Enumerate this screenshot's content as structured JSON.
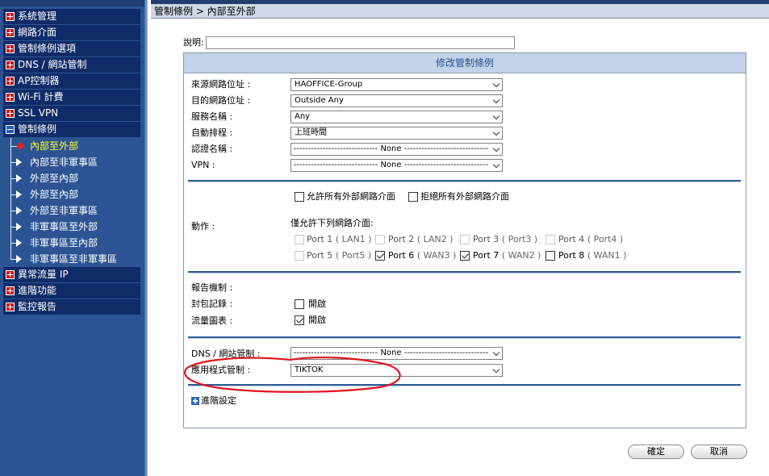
{
  "sidebar": {
    "items": [
      {
        "label": "系統管理",
        "type": "plus"
      },
      {
        "label": "網路介面",
        "type": "plus"
      },
      {
        "label": "管制條例選項",
        "type": "plus"
      },
      {
        "label": "DNS / 網站管制",
        "type": "plus"
      },
      {
        "label": "AP控制器",
        "type": "plus"
      },
      {
        "label": "Wi-Fi 計費",
        "type": "plus"
      },
      {
        "label": "SSL VPN",
        "type": "plus"
      },
      {
        "label": "管制條例",
        "type": "minus"
      }
    ],
    "subitems": [
      {
        "label": "內部至外部",
        "active": true
      },
      {
        "label": "內部至非軍事區"
      },
      {
        "label": "外部至內部"
      },
      {
        "label": "外部至內部"
      },
      {
        "label": "外部至非軍事區"
      },
      {
        "label": "非軍事區至外部"
      },
      {
        "label": "非軍事區至內部"
      },
      {
        "label": "非軍事區至非軍事區"
      }
    ],
    "items_after": [
      {
        "label": "異常流量 IP"
      },
      {
        "label": "進階功能"
      },
      {
        "label": "監控報告"
      }
    ]
  },
  "header": {
    "breadcrumb": "管制條例 > 內部至外部"
  },
  "form": {
    "description_label": "說明:",
    "description_value": "",
    "panel_title": "修改管制條例",
    "fields": [
      {
        "label": "來源網路位址 :",
        "value": "HAOFFICE-Group"
      },
      {
        "label": "目的網路位址 :",
        "value": "Outside Any"
      },
      {
        "label": "服務名稱 :",
        "value": "Any"
      },
      {
        "label": "自動排程 :",
        "value": "上班時間"
      },
      {
        "label": "認證名稱 :",
        "value": "----------------------------- None -----------------------------"
      },
      {
        "label": "VPN :",
        "value": "----------------------------- None -----------------------------"
      }
    ],
    "action": {
      "label": "動作 :",
      "allow_all": "允許所有外部網路介面",
      "deny_all": "拒絕所有外部網路介面",
      "allow_below": "僅允許下列網路介面:",
      "ports": [
        {
          "name": "Port 1",
          "iface": "( LAN1 )",
          "checked": false,
          "disabled": true
        },
        {
          "name": "Port 2",
          "iface": "( LAN2 )",
          "checked": false,
          "disabled": true
        },
        {
          "name": "Port 3",
          "iface": "( Port3 )",
          "checked": false,
          "disabled": true
        },
        {
          "name": "Port 4",
          "iface": "( Port4 )",
          "checked": false,
          "disabled": true
        },
        {
          "name": "Port 5",
          "iface": "( Port5 )",
          "checked": false,
          "disabled": true
        },
        {
          "name": "Port 6",
          "iface": "( WAN3 )",
          "checked": true,
          "disabled": false
        },
        {
          "name": "Port 7",
          "iface": "( WAN2 )",
          "checked": true,
          "disabled": false
        },
        {
          "name": "Port 8",
          "iface": "( WAN1 )",
          "checked": false,
          "disabled": false
        }
      ]
    },
    "report_label": "報告機制 :",
    "packet_log_label": "封包記錄 :",
    "packet_log_option": "開啟",
    "flow_chart_label": "流量圖表 :",
    "flow_chart_option": "開啟",
    "dns_label": "DNS / 網站管制 :",
    "dns_value": "----------------------------- None -----------------------------",
    "app_label": "應用程式管制 :",
    "app_value": "TIKTOK",
    "advanced_label": "進階設定",
    "ok_button": "確定",
    "cancel_button": "取消"
  },
  "colors": {
    "sidebar": "#2c5493",
    "menu_item": "#0f2c68",
    "panel_title": "#c3d2e8",
    "annotation": "#e0141e"
  }
}
